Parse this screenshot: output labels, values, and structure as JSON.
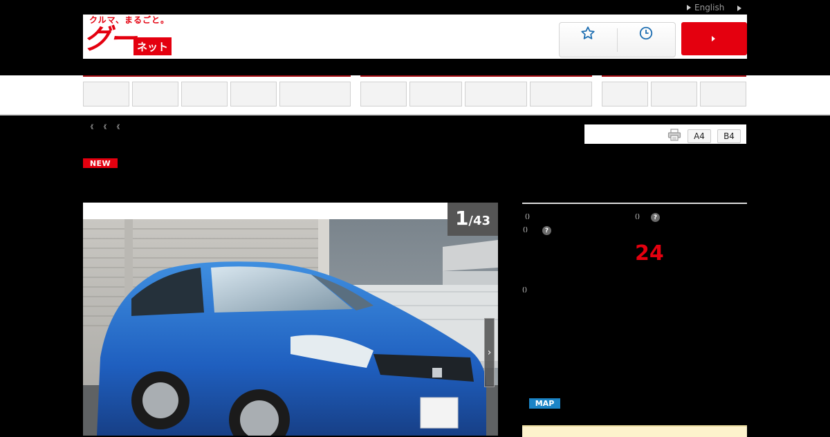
{
  "topbar": {
    "language_label": "English"
  },
  "header": {
    "logo_tagline": "クルマ、まるごと。",
    "logo_main": "グー",
    "logo_sub": "ネット",
    "favorites_icon": "star-icon",
    "history_icon": "clock-icon",
    "primary_button_icon": "triangle-right-icon"
  },
  "breadcrumb": {
    "items": [
      "《",
      "《",
      "《"
    ]
  },
  "print": {
    "icon": "printer-icon",
    "a4_label": "A4",
    "b4_label": "B4"
  },
  "listing": {
    "new_badge": "NEW",
    "gallery": {
      "current": "1",
      "total": "/43",
      "next_icon": "chevron-right-icon"
    },
    "info": {
      "paren_1": "()",
      "paren_2": "()",
      "paren_3": "()",
      "paren_4": "()",
      "help_1": "?",
      "help_2": "?",
      "big_number": "24",
      "map_label": "MAP"
    }
  },
  "colors": {
    "brand_red": "#e4000f",
    "nav_rule": "#a80d13",
    "map_blue": "#1b84c6",
    "cream": "#fdf2cc"
  }
}
